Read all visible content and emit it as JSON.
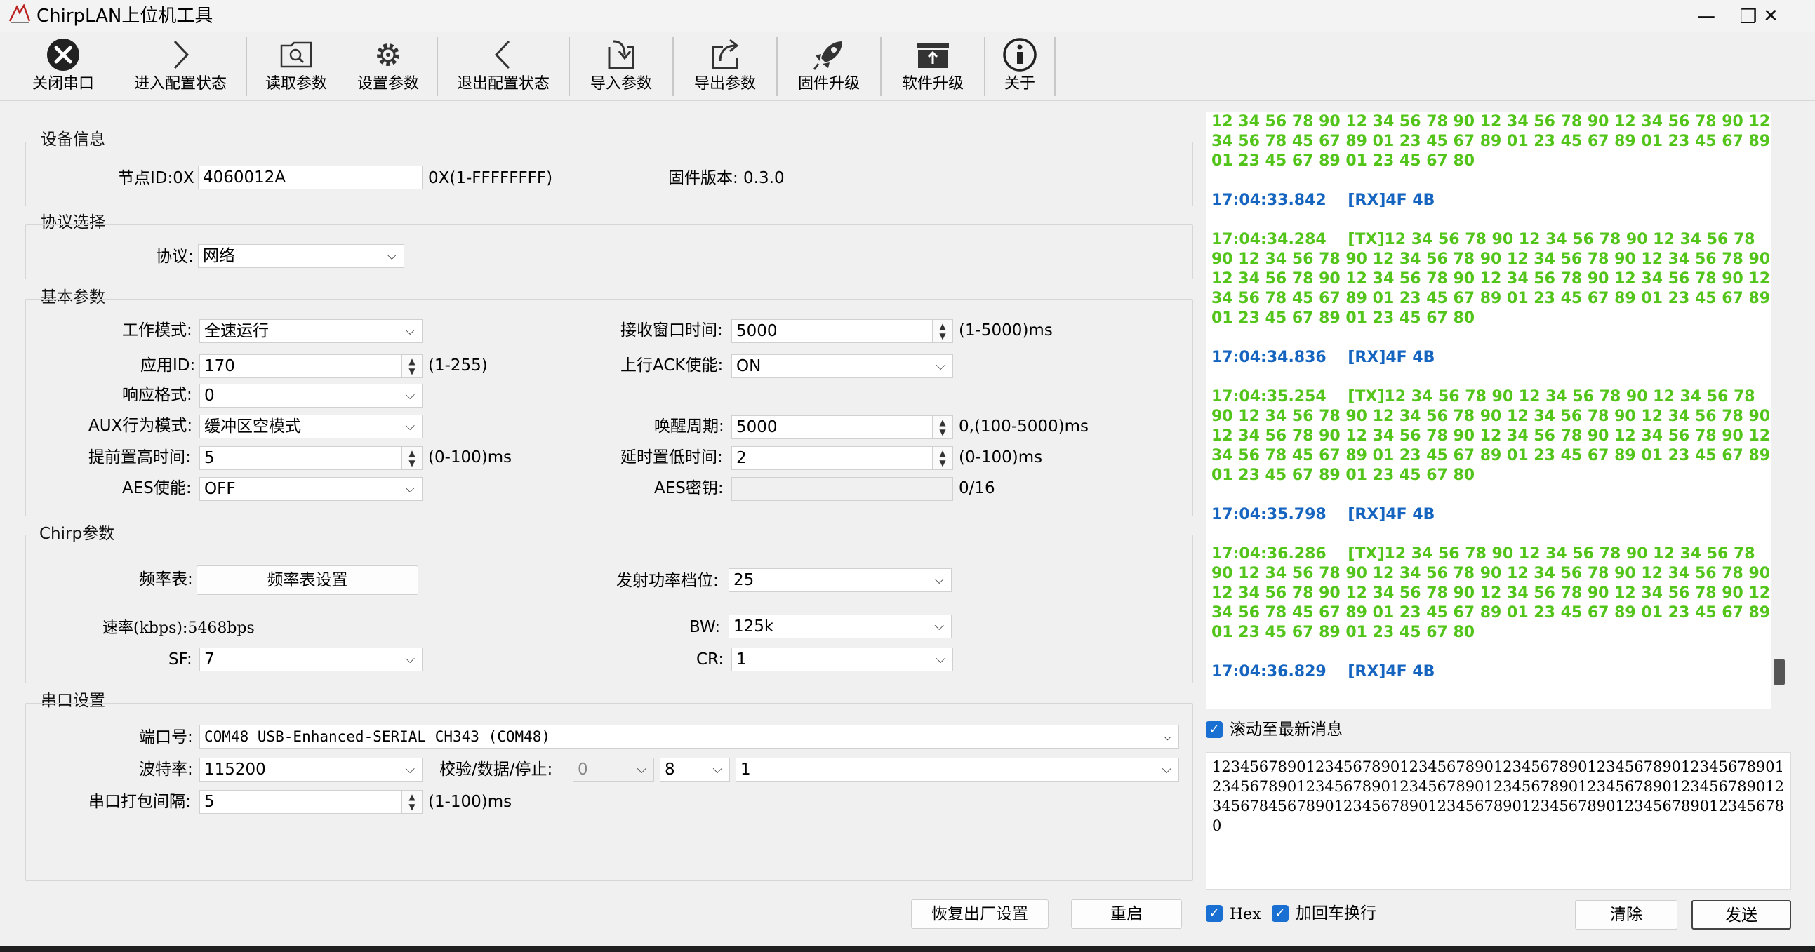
{
  "window": {
    "title": "ChirpLAN上位机工具",
    "minimize": "—",
    "maximize": "❐",
    "close": "✕"
  },
  "toolbar": [
    {
      "label": "关闭串口",
      "icon": "close-circle-icon"
    },
    {
      "label": "进入配置状态",
      "icon": "chevron-right-icon"
    },
    {
      "label": "读取参数",
      "icon": "read-params-icon"
    },
    {
      "label": "设置参数",
      "icon": "gear-icon"
    },
    {
      "label": "退出配置状态",
      "icon": "chevron-left-icon"
    },
    {
      "label": "导入参数",
      "icon": "import-icon"
    },
    {
      "label": "导出参数",
      "icon": "export-icon"
    },
    {
      "label": "固件升级",
      "icon": "rocket-icon"
    },
    {
      "label": "软件升级",
      "icon": "upload-box-icon"
    },
    {
      "label": "关于",
      "icon": "info-icon"
    }
  ],
  "device_info": {
    "title": "设备信息",
    "node_id_label": "节点ID:0X",
    "node_id_value": "4060012A",
    "node_id_hint": "0X(1-FFFFFFFF)",
    "firmware": "固件版本: 0.3.0"
  },
  "protocol": {
    "title": "协议选择",
    "label": "协议:",
    "value": "网络"
  },
  "basic": {
    "title": "基本参数",
    "work_mode_label": "工作模式:",
    "work_mode": "全速运行",
    "app_id_label": "应用ID:",
    "app_id": "170",
    "app_id_hint": "(1-255)",
    "resp_format_label": "响应格式:",
    "resp_format": "0",
    "aux_label": "AUX行为模式:",
    "aux": "缓冲区空模式",
    "pre_high_label": "提前置高时间:",
    "pre_high": "5",
    "pre_high_hint": "(0-100)ms",
    "aes_label": "AES使能:",
    "aes": "OFF",
    "rx_window_label": "接收窗口时间:",
    "rx_window": "5000",
    "rx_window_hint": "(1-5000)ms",
    "ack_label": "上行ACK使能:",
    "ack": "ON",
    "wake_label": "唤醒周期:",
    "wake": "5000",
    "wake_hint": "0,(100-5000)ms",
    "delay_low_label": "延时置低时间:",
    "delay_low": "2",
    "delay_low_hint": "(0-100)ms",
    "aes_key_label": "AES密钥:",
    "aes_key": "",
    "aes_key_hint": "0/16"
  },
  "chirp": {
    "title": "Chirp参数",
    "freq_table_label": "频率表:",
    "freq_table_button": "频率表设置",
    "rate_text": "速率(kbps):5468bps",
    "sf_label": "SF:",
    "sf": "7",
    "power_label": "发射功率档位:",
    "power": "25",
    "bw_label": "BW:",
    "bw": "125k",
    "cr_label": "CR:",
    "cr": "1"
  },
  "serial": {
    "title": "串口设置",
    "port_label": "端口号:",
    "port": "COM48 USB-Enhanced-SERIAL CH343 (COM48)",
    "baud_label": "波特率:",
    "baud": "115200",
    "parity_label": "校验/数据/停止:",
    "parity": "0",
    "data_bits": "8",
    "stop_bits": "1",
    "interval_label": "串口打包间隔:",
    "interval": "5",
    "interval_hint": "(1-100)ms"
  },
  "actions": {
    "factory_reset": "恢复出厂设置",
    "restart": "重启"
  },
  "log": [
    {
      "kind": "tx",
      "text": "12 34 56 78 90 12 34 56 78 90 12 34 56 78 90 12 34 56 78 90 12 34 56 78 45 67 89 01 23 45 67 89 01 23 45 67 89 01 23 45 67 89 01 23 45 67 89 01 23 45 67 80"
    },
    {
      "kind": "rx",
      "text": "17:04:33.842    [RX]4F 4B"
    },
    {
      "kind": "tx",
      "text": "17:04:34.284    [TX]12 34 56 78 90 12 34 56 78 90 12 34 56 78 90 12 34 56 78 90 12 34 56 78 90 12 34 56 78 90 12 34 56 78 90 12 34 56 78 90 12 34 56 78 90 12 34 56 78 90 12 34 56 78 90 12 34 56 78 45 67 89 01 23 45 67 89 01 23 45 67 89 01 23 45 67 89 01 23 45 67 89 01 23 45 67 80"
    },
    {
      "kind": "rx",
      "text": "17:04:34.836    [RX]4F 4B"
    },
    {
      "kind": "tx",
      "text": "17:04:35.254    [TX]12 34 56 78 90 12 34 56 78 90 12 34 56 78 90 12 34 56 78 90 12 34 56 78 90 12 34 56 78 90 12 34 56 78 90 12 34 56 78 90 12 34 56 78 90 12 34 56 78 90 12 34 56 78 90 12 34 56 78 45 67 89 01 23 45 67 89 01 23 45 67 89 01 23 45 67 89 01 23 45 67 89 01 23 45 67 80"
    },
    {
      "kind": "rx",
      "text": "17:04:35.798    [RX]4F 4B"
    },
    {
      "kind": "tx",
      "text": "17:04:36.286    [TX]12 34 56 78 90 12 34 56 78 90 12 34 56 78 90 12 34 56 78 90 12 34 56 78 90 12 34 56 78 90 12 34 56 78 90 12 34 56 78 90 12 34 56 78 90 12 34 56 78 90 12 34 56 78 90 12 34 56 78 45 67 89 01 23 45 67 89 01 23 45 67 89 01 23 45 67 89 01 23 45 67 89 01 23 45 67 80"
    },
    {
      "kind": "rx",
      "text": "17:04:36.829    [RX]4F 4B"
    }
  ],
  "scroll_latest": "滚动至最新消息",
  "send_text": "1234567890123456789012345678901234567890123456789012345678901234567890123456789012345678901234567890123456789012345678901234567845678901234567890123456789012345678901234567890123456780",
  "hex_label": "Hex",
  "crlf_label": "加回车换行",
  "clear_button": "清除",
  "send_button": "发送",
  "colors": {
    "rx": "#1565c0",
    "tx": "#52c41a",
    "check": "#1a6fd2"
  }
}
